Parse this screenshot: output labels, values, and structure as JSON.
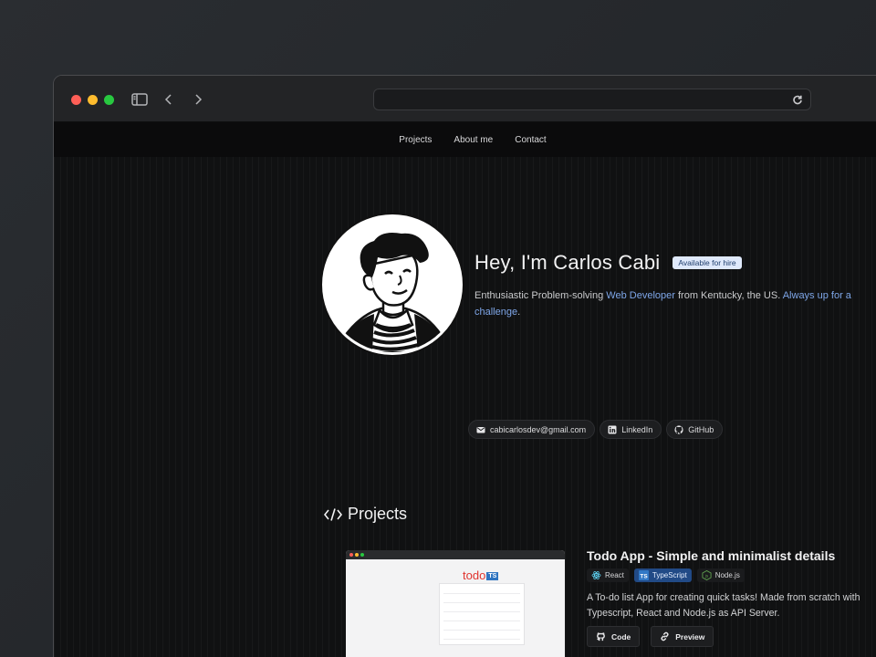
{
  "nav": {
    "items": [
      "Projects",
      "About me",
      "Contact"
    ]
  },
  "hero": {
    "title": "Hey, I'm Carlos Cabi",
    "badge": "Available for hire",
    "bio_1": "Enthusiastic Problem-solving ",
    "bio_hl_1": "Web Developer",
    "bio_2": " from Kentucky, the US. ",
    "bio_hl_2": "Always up for a challenge",
    "bio_3": "."
  },
  "socials": {
    "email": "cabicarlosdev@gmail.com",
    "linkedin": "LinkedIn",
    "github": "GitHub"
  },
  "projects": {
    "title": "Projects",
    "items": [
      {
        "name": "Todo App - Simple and minimalist details",
        "tags": [
          "React",
          "TypeScript",
          "Node.js"
        ],
        "description": "A To-do list App for creating quick tasks! Made from scratch with Typescript, React and Node.js as API Server.",
        "code_label": "Code",
        "preview_label": "Preview",
        "thumb_logo": "todo",
        "thumb_logo_tag": "TS"
      }
    ]
  },
  "colors": {
    "accent": "#7ea6e8",
    "badge_bg": "#dfe9fb",
    "ts_tag": "#214a86"
  }
}
